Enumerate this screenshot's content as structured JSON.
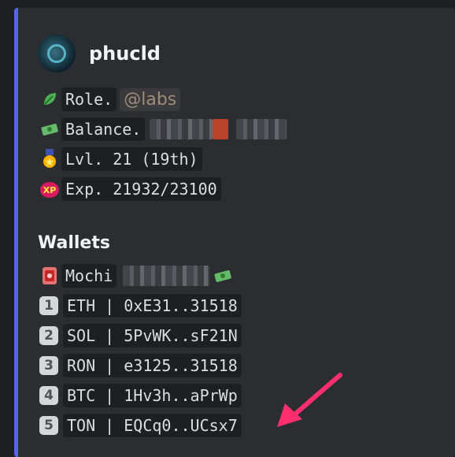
{
  "author": {
    "name": "phucld"
  },
  "fields": {
    "role_label": "Role.",
    "role_mention": "@labs",
    "balance_label": "Balance.",
    "level_label": "Lvl. 21 (19th)",
    "exp_label": "Exp. 21932/23100"
  },
  "wallets": {
    "heading": "Wallets",
    "mochi_label": "Mochi",
    "items": [
      {
        "num": "1",
        "text": "ETH | 0xE31..31518"
      },
      {
        "num": "2",
        "text": "SOL | 5PvWK..sF21N"
      },
      {
        "num": "3",
        "text": "RON | e3125..31518"
      },
      {
        "num": "4",
        "text": "BTC | 1Hv3h..aPrWp"
      },
      {
        "num": "5",
        "text": "TON | EQCq0..UCsx7"
      }
    ]
  },
  "icons": {
    "role": "leaf-icon",
    "balance": "money-icon",
    "level": "medal-icon",
    "exp": "xp-icon",
    "mochi": "mochi-wallet-icon"
  },
  "colors": {
    "accent_bar": "#5865f2",
    "annotation_arrow": "#ff2e6f"
  }
}
